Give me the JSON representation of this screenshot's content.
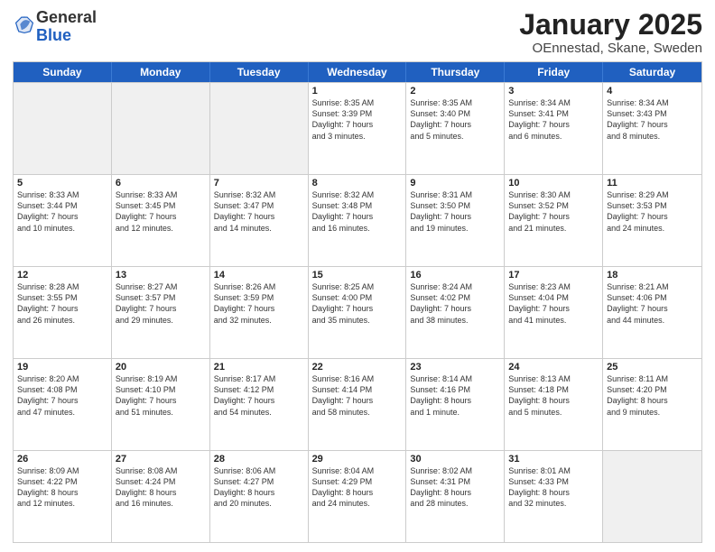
{
  "header": {
    "logo_general": "General",
    "logo_blue": "Blue",
    "cal_title": "January 2025",
    "cal_subtitle": "OEnnestad, Skane, Sweden"
  },
  "dow": [
    "Sunday",
    "Monday",
    "Tuesday",
    "Wednesday",
    "Thursday",
    "Friday",
    "Saturday"
  ],
  "weeks": [
    [
      {
        "day": "",
        "info": "",
        "shaded": true
      },
      {
        "day": "",
        "info": "",
        "shaded": true
      },
      {
        "day": "",
        "info": "",
        "shaded": true
      },
      {
        "day": "1",
        "info": "Sunrise: 8:35 AM\nSunset: 3:39 PM\nDaylight: 7 hours\nand 3 minutes.",
        "shaded": false
      },
      {
        "day": "2",
        "info": "Sunrise: 8:35 AM\nSunset: 3:40 PM\nDaylight: 7 hours\nand 5 minutes.",
        "shaded": false
      },
      {
        "day": "3",
        "info": "Sunrise: 8:34 AM\nSunset: 3:41 PM\nDaylight: 7 hours\nand 6 minutes.",
        "shaded": false
      },
      {
        "day": "4",
        "info": "Sunrise: 8:34 AM\nSunset: 3:43 PM\nDaylight: 7 hours\nand 8 minutes.",
        "shaded": false
      }
    ],
    [
      {
        "day": "5",
        "info": "Sunrise: 8:33 AM\nSunset: 3:44 PM\nDaylight: 7 hours\nand 10 minutes.",
        "shaded": false
      },
      {
        "day": "6",
        "info": "Sunrise: 8:33 AM\nSunset: 3:45 PM\nDaylight: 7 hours\nand 12 minutes.",
        "shaded": false
      },
      {
        "day": "7",
        "info": "Sunrise: 8:32 AM\nSunset: 3:47 PM\nDaylight: 7 hours\nand 14 minutes.",
        "shaded": false
      },
      {
        "day": "8",
        "info": "Sunrise: 8:32 AM\nSunset: 3:48 PM\nDaylight: 7 hours\nand 16 minutes.",
        "shaded": false
      },
      {
        "day": "9",
        "info": "Sunrise: 8:31 AM\nSunset: 3:50 PM\nDaylight: 7 hours\nand 19 minutes.",
        "shaded": false
      },
      {
        "day": "10",
        "info": "Sunrise: 8:30 AM\nSunset: 3:52 PM\nDaylight: 7 hours\nand 21 minutes.",
        "shaded": false
      },
      {
        "day": "11",
        "info": "Sunrise: 8:29 AM\nSunset: 3:53 PM\nDaylight: 7 hours\nand 24 minutes.",
        "shaded": false
      }
    ],
    [
      {
        "day": "12",
        "info": "Sunrise: 8:28 AM\nSunset: 3:55 PM\nDaylight: 7 hours\nand 26 minutes.",
        "shaded": false
      },
      {
        "day": "13",
        "info": "Sunrise: 8:27 AM\nSunset: 3:57 PM\nDaylight: 7 hours\nand 29 minutes.",
        "shaded": false
      },
      {
        "day": "14",
        "info": "Sunrise: 8:26 AM\nSunset: 3:59 PM\nDaylight: 7 hours\nand 32 minutes.",
        "shaded": false
      },
      {
        "day": "15",
        "info": "Sunrise: 8:25 AM\nSunset: 4:00 PM\nDaylight: 7 hours\nand 35 minutes.",
        "shaded": false
      },
      {
        "day": "16",
        "info": "Sunrise: 8:24 AM\nSunset: 4:02 PM\nDaylight: 7 hours\nand 38 minutes.",
        "shaded": false
      },
      {
        "day": "17",
        "info": "Sunrise: 8:23 AM\nSunset: 4:04 PM\nDaylight: 7 hours\nand 41 minutes.",
        "shaded": false
      },
      {
        "day": "18",
        "info": "Sunrise: 8:21 AM\nSunset: 4:06 PM\nDaylight: 7 hours\nand 44 minutes.",
        "shaded": false
      }
    ],
    [
      {
        "day": "19",
        "info": "Sunrise: 8:20 AM\nSunset: 4:08 PM\nDaylight: 7 hours\nand 47 minutes.",
        "shaded": false
      },
      {
        "day": "20",
        "info": "Sunrise: 8:19 AM\nSunset: 4:10 PM\nDaylight: 7 hours\nand 51 minutes.",
        "shaded": false
      },
      {
        "day": "21",
        "info": "Sunrise: 8:17 AM\nSunset: 4:12 PM\nDaylight: 7 hours\nand 54 minutes.",
        "shaded": false
      },
      {
        "day": "22",
        "info": "Sunrise: 8:16 AM\nSunset: 4:14 PM\nDaylight: 7 hours\nand 58 minutes.",
        "shaded": false
      },
      {
        "day": "23",
        "info": "Sunrise: 8:14 AM\nSunset: 4:16 PM\nDaylight: 8 hours\nand 1 minute.",
        "shaded": false
      },
      {
        "day": "24",
        "info": "Sunrise: 8:13 AM\nSunset: 4:18 PM\nDaylight: 8 hours\nand 5 minutes.",
        "shaded": false
      },
      {
        "day": "25",
        "info": "Sunrise: 8:11 AM\nSunset: 4:20 PM\nDaylight: 8 hours\nand 9 minutes.",
        "shaded": false
      }
    ],
    [
      {
        "day": "26",
        "info": "Sunrise: 8:09 AM\nSunset: 4:22 PM\nDaylight: 8 hours\nand 12 minutes.",
        "shaded": false
      },
      {
        "day": "27",
        "info": "Sunrise: 8:08 AM\nSunset: 4:24 PM\nDaylight: 8 hours\nand 16 minutes.",
        "shaded": false
      },
      {
        "day": "28",
        "info": "Sunrise: 8:06 AM\nSunset: 4:27 PM\nDaylight: 8 hours\nand 20 minutes.",
        "shaded": false
      },
      {
        "day": "29",
        "info": "Sunrise: 8:04 AM\nSunset: 4:29 PM\nDaylight: 8 hours\nand 24 minutes.",
        "shaded": false
      },
      {
        "day": "30",
        "info": "Sunrise: 8:02 AM\nSunset: 4:31 PM\nDaylight: 8 hours\nand 28 minutes.",
        "shaded": false
      },
      {
        "day": "31",
        "info": "Sunrise: 8:01 AM\nSunset: 4:33 PM\nDaylight: 8 hours\nand 32 minutes.",
        "shaded": false
      },
      {
        "day": "",
        "info": "",
        "shaded": true
      }
    ]
  ]
}
